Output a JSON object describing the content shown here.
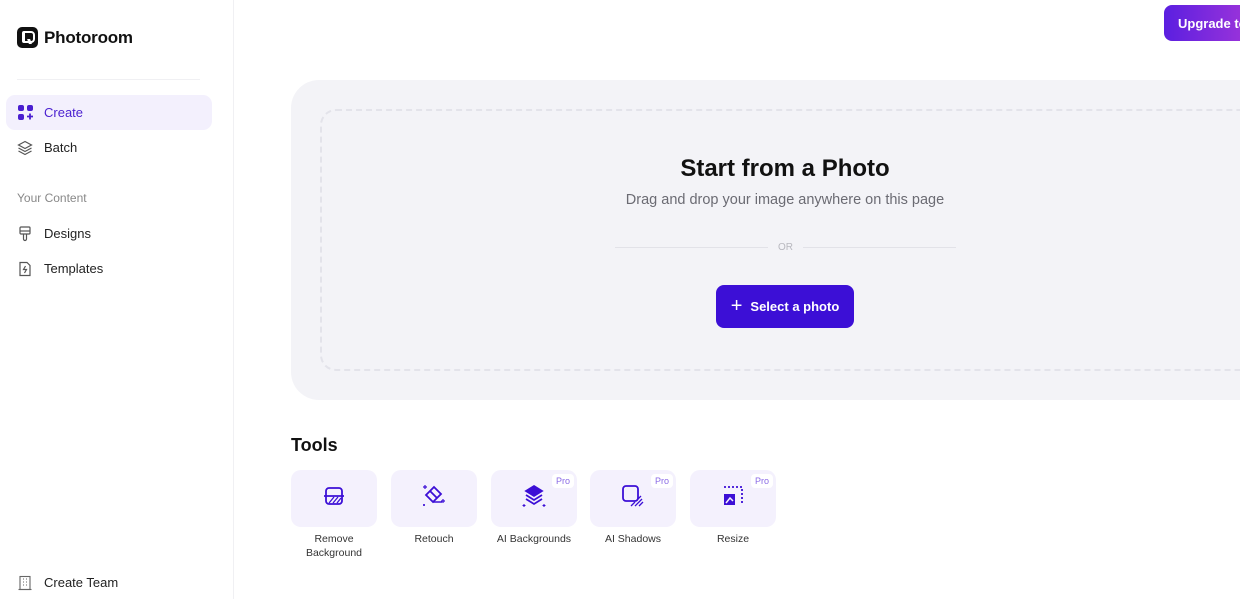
{
  "app": {
    "name": "Photoroom"
  },
  "sidebar": {
    "items": [
      {
        "label": "Create",
        "icon": "grid-plus-icon",
        "active": true
      },
      {
        "label": "Batch",
        "icon": "layers-icon",
        "active": false
      }
    ],
    "section_label": "Your Content",
    "content_items": [
      {
        "label": "Designs",
        "icon": "paint-brush-icon"
      },
      {
        "label": "Templates",
        "icon": "file-bolt-icon"
      }
    ],
    "footer_item": {
      "label": "Create Team",
      "icon": "building-icon"
    }
  },
  "header": {
    "upgrade_label": "Upgrade to Pro"
  },
  "dropzone": {
    "title": "Start from a Photo",
    "subtitle": "Drag and drop your image anywhere on this page",
    "or_label": "OR",
    "select_label": "Select a photo"
  },
  "tools": {
    "title": "Tools",
    "items": [
      {
        "label": "Remove Background",
        "icon": "remove-background-icon",
        "pro": false
      },
      {
        "label": "Retouch",
        "icon": "eraser-sparkle-icon",
        "pro": false
      },
      {
        "label": "AI Backgrounds",
        "icon": "ai-layers-icon",
        "pro": true
      },
      {
        "label": "AI Shadows",
        "icon": "shadow-square-icon",
        "pro": true
      },
      {
        "label": "Resize",
        "icon": "resize-icon",
        "pro": true
      }
    ],
    "pro_label": "Pro"
  },
  "colors": {
    "accent": "#3c0fd6",
    "active_bg": "#f3f0fd",
    "tile_bg": "#f4f1fd"
  }
}
